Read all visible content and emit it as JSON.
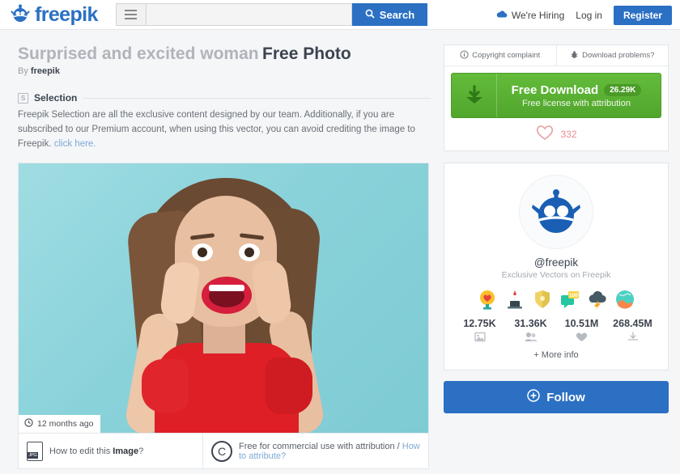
{
  "header": {
    "logo_text": "freepik",
    "menu_icon": "hamburger-icon",
    "search": {
      "value": "",
      "placeholder": "",
      "button_label": "Search",
      "icon": "search-icon"
    },
    "hiring_label": "We're Hiring",
    "hiring_icon": "cloud-icon",
    "login_label": "Log in",
    "register_label": "Register"
  },
  "title": {
    "main": "Surprised and excited woman",
    "suffix": "Free Photo",
    "by_prefix": "By",
    "author": "freepik"
  },
  "selection": {
    "badge": "S",
    "heading": "Selection",
    "body": "Freepik Selection are all the exclusive content designed by our team. Additionally, if you are subscribed to our Premium account, when using this vector, you can avoid crediting the image to Freepik.",
    "link_label": "click here."
  },
  "photo": {
    "alt": "Surprised and excited woman with hands on cheeks on turquoise background",
    "time_badge": "12 months ago",
    "clock_icon": "clock-icon",
    "edit_prefix": "How to edit this",
    "edit_bold": "Image",
    "edit_suffix": "?",
    "file_icon": "jpg-file-icon",
    "license_icon": "copyright-icon",
    "license_text": "Free for commercial use with attribution /",
    "license_link": "How to attribute?"
  },
  "download": {
    "tabs": [
      {
        "label": "Copyright complaint",
        "icon": "info-circle-icon"
      },
      {
        "label": "Download problems?",
        "icon": "bug-icon"
      }
    ],
    "button_label": "Free Download",
    "count": "26.29K",
    "sub_label": "Free license with attribution",
    "download_icon": "download-icon",
    "likes": "332",
    "heart_icon": "heart-outline-icon",
    "accent_green": "#5cb335"
  },
  "author_card": {
    "avatar_icon": "freepik-robot-avatar",
    "handle": "@freepik",
    "subtitle": "Exclusive Vectors on Freepik",
    "badges": [
      "trophy-heart-badge",
      "magic-hat-badge",
      "shield-badge",
      "hundred-speech-bubble-badge",
      "storm-cloud-badge",
      "globe-badge"
    ],
    "stats": [
      {
        "value": "12.75K",
        "icon": "image-icon"
      },
      {
        "value": "31.36K",
        "icon": "followers-icon"
      },
      {
        "value": "10.51M",
        "icon": "heart-filled-icon"
      },
      {
        "value": "268.45M",
        "icon": "download-tray-icon"
      }
    ],
    "more_info": "+ More info",
    "follow_label": "Follow",
    "follow_icon": "plus-circle-icon",
    "accent_blue": "#2b70c3"
  }
}
